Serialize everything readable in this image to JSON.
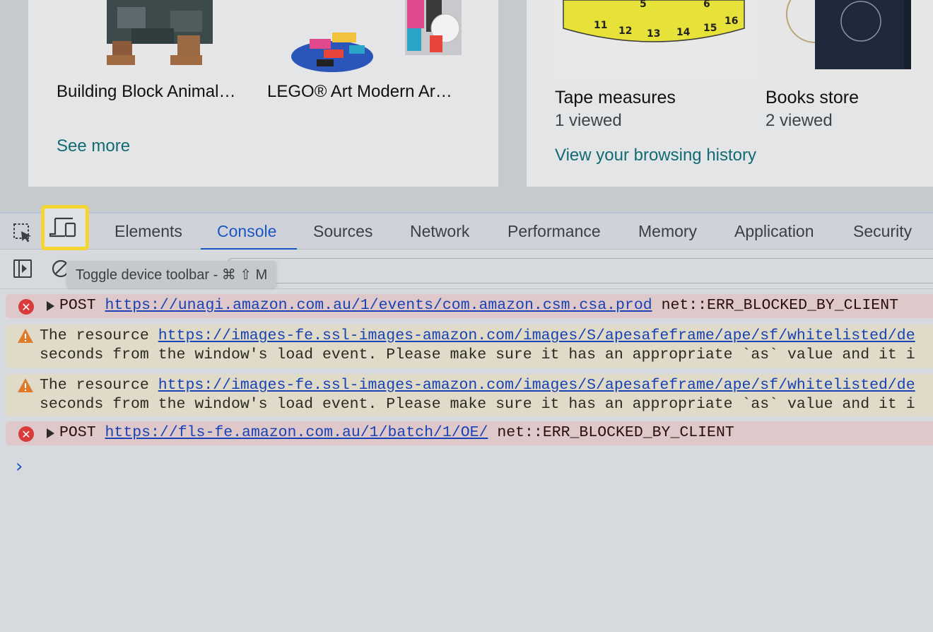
{
  "page": {
    "products": [
      {
        "title": "Building Block Animal…"
      },
      {
        "title": "LEGO® Art Modern Ar…"
      }
    ],
    "see_more": "See more",
    "history": [
      {
        "title": "Tape measures",
        "sub": "1 viewed"
      },
      {
        "title": "Books store",
        "sub": "2 viewed"
      }
    ],
    "history_link": "View your browsing history"
  },
  "devtools": {
    "tabs": [
      "Elements",
      "Console",
      "Sources",
      "Network",
      "Performance",
      "Memory",
      "Application",
      "Security"
    ],
    "active_tab": "Console",
    "tooltip": "Toggle device toolbar - ⌘ ⇧ M",
    "messages": [
      {
        "level": "error",
        "method": "POST",
        "url": "https://unagi.amazon.com.au/1/events/com.amazon.csm.csa.prod",
        "status": "net::ERR_BLOCKED_BY_CLIENT"
      },
      {
        "level": "warning",
        "prefix": "The resource",
        "url": "https://images-fe.ssl-images-amazon.com/images/S/apesafeframe/ape/sf/whitelisted/de",
        "line2": "seconds from the window's load event. Please make sure it has an appropriate `as` value and it i"
      },
      {
        "level": "warning",
        "prefix": "The resource",
        "url": "https://images-fe.ssl-images-amazon.com/images/S/apesafeframe/ape/sf/whitelisted/de",
        "line2": "seconds from the window's load event. Please make sure it has an appropriate `as` value and it i"
      },
      {
        "level": "error",
        "method": "POST",
        "url": "https://fls-fe.amazon.com.au/1/batch/1/OE/",
        "status": "net::ERR_BLOCKED_BY_CLIENT"
      }
    ],
    "prompt": "›"
  },
  "colors": {
    "accent": "#1a56c2",
    "highlight": "#f5d532",
    "link": "#126b73"
  }
}
